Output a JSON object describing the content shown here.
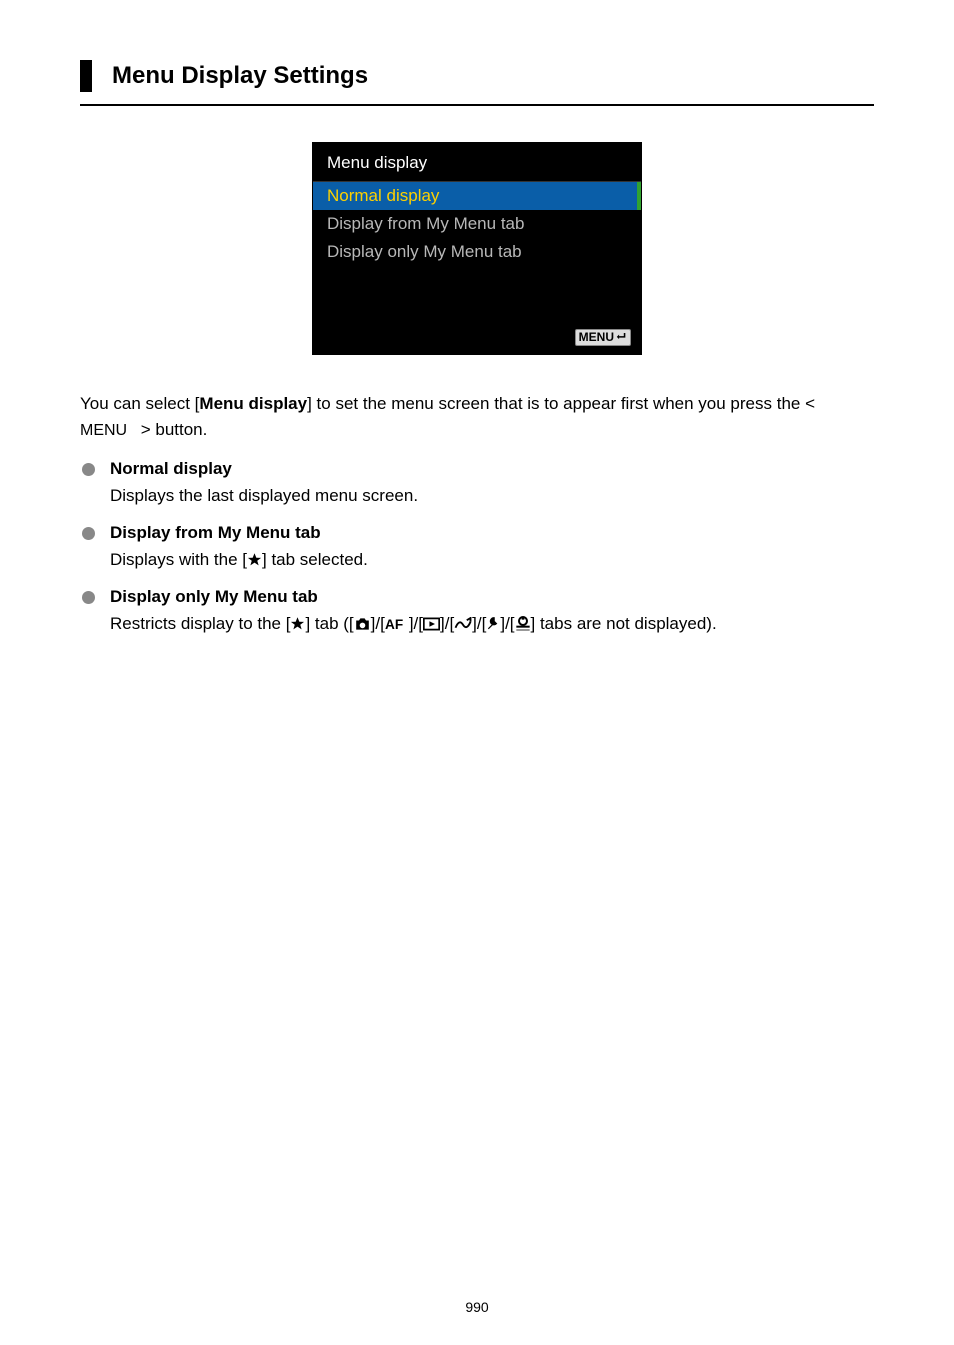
{
  "title": "Menu Display Settings",
  "screenshot": {
    "header": "Menu display",
    "options": [
      {
        "label": "Normal display",
        "selected": true
      },
      {
        "label": "Display from My Menu tab",
        "selected": false
      },
      {
        "label": "Display only My Menu tab",
        "selected": false
      }
    ],
    "footer_button": "MENU"
  },
  "intro": {
    "pre": "You can select [",
    "bold": "Menu display",
    "mid": "] to set the menu screen that is to appear first when you press the < ",
    "menu_word": "MENU",
    "post": " > button."
  },
  "bullets": [
    {
      "title": "Normal display",
      "body_plain": "Displays the last displayed menu screen."
    },
    {
      "title": "Display from My Menu tab",
      "body_prefix": "Displays with the [",
      "body_suffix": "] tab selected."
    },
    {
      "title": "Display only My Menu tab",
      "body_prefix": "Restricts display to the [",
      "body_mid1": "] tab ([",
      "body_mid2": "]/[",
      "body_suffix": "] tabs are not displayed)."
    }
  ],
  "page_number": "990"
}
